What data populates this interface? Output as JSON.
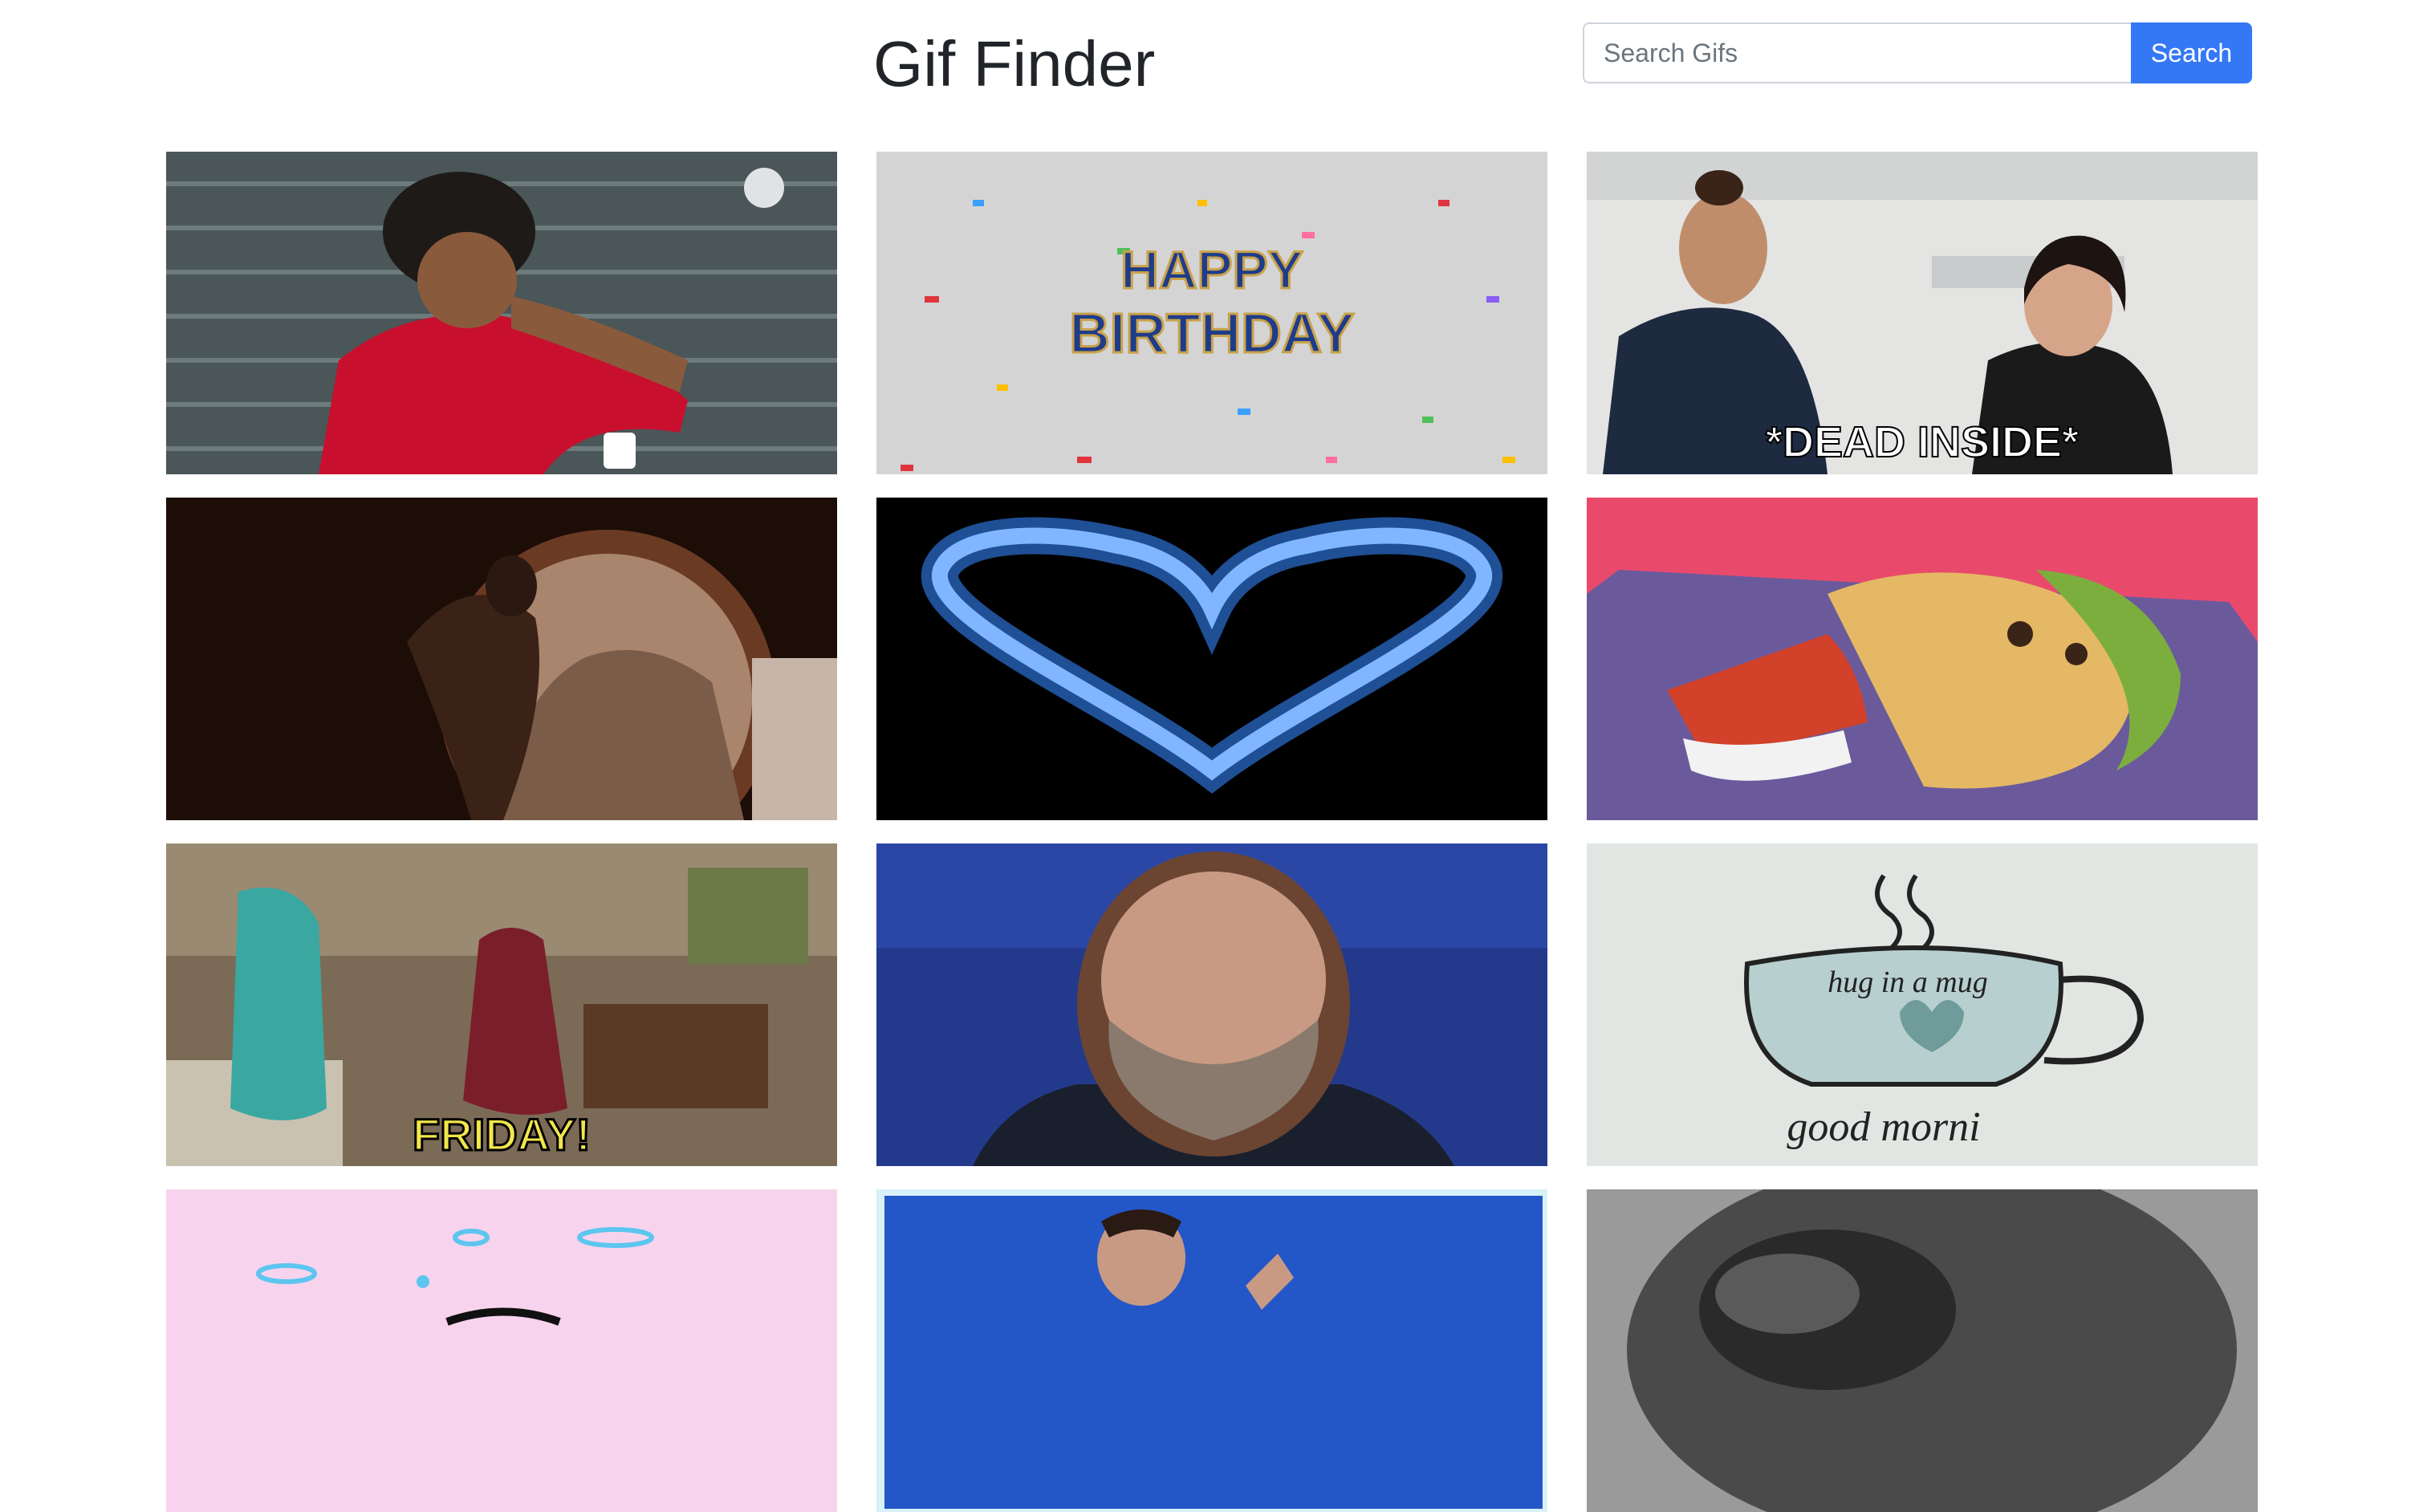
{
  "header": {
    "title": "Gif Finder",
    "search_placeholder": "Search Gifs",
    "search_button": "Search"
  },
  "gifs": [
    {
      "subject": "soccer player in red jersey",
      "caption": ""
    },
    {
      "subject": "happy birthday confetti",
      "caption": "HAPPY BIRTHDAY"
    },
    {
      "subject": "man and woman laughing",
      "caption": "*DEAD INSIDE*"
    },
    {
      "subject": "dark figure on a chariot",
      "caption": ""
    },
    {
      "subject": "glowing blue heart",
      "caption": ""
    },
    {
      "subject": "taco with hot sauce",
      "caption": ""
    },
    {
      "subject": "people dancing in a living room",
      "caption": "FRIDAY!"
    },
    {
      "subject": "bearded man",
      "caption": ""
    },
    {
      "subject": "mug of coffee",
      "caption": "hug in a mug good morni"
    },
    {
      "subject": "pink background with blue shapes",
      "caption": ""
    },
    {
      "subject": "man dancing",
      "caption": ""
    },
    {
      "subject": "black and white gorilla",
      "caption": ""
    }
  ],
  "colors": {
    "accent": "#3478f6",
    "title": "#212529"
  }
}
